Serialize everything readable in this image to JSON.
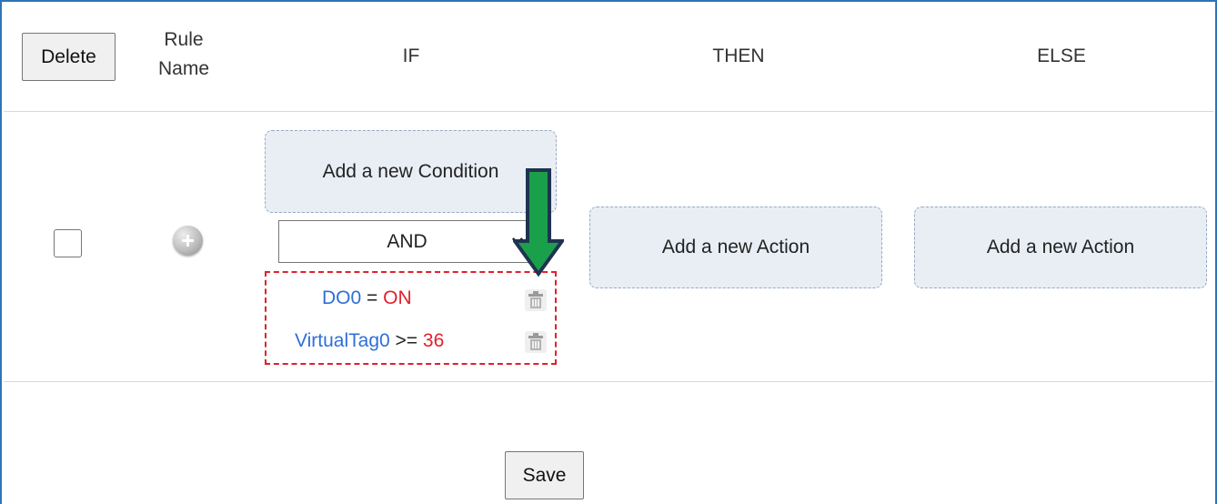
{
  "header": {
    "delete_label": "Delete",
    "rule_name_line1": "Rule",
    "rule_name_line2": "Name",
    "if_label": "IF",
    "then_label": "THEN",
    "else_label": "ELSE"
  },
  "rule": {
    "add_condition_label": "Add a new Condition",
    "logic_select_value": "AND",
    "conditions": [
      {
        "tag": "DO0",
        "operator": "=",
        "value": "ON"
      },
      {
        "tag": "VirtualTag0",
        "operator": ">=",
        "value": "36"
      }
    ],
    "then_action_label": "Add a new Action",
    "else_action_label": "Add a new Action"
  },
  "footer": {
    "save_label": "Save"
  },
  "colors": {
    "frame_border": "#2e75b6",
    "tag_blue": "#2e6fd8",
    "value_red": "#e0212c",
    "highlight_dash": "#e0212c",
    "arrow_green": "#1aa04a",
    "arrow_outline": "#1f3350"
  },
  "icons": {
    "add_rule": "plus-circle-icon",
    "delete_condition": "trash-icon",
    "select_chevron": "chevron-down-icon",
    "annotation_arrow": "down-arrow-icon"
  }
}
